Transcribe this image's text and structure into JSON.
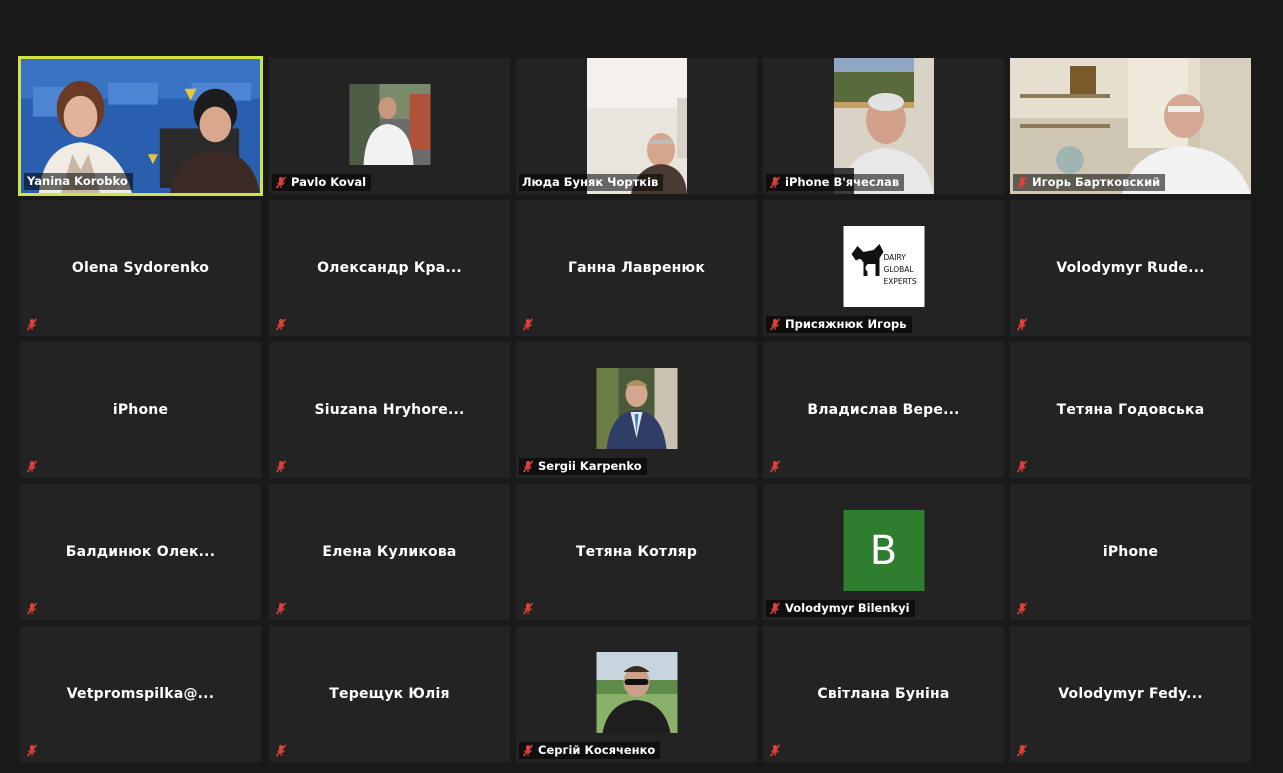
{
  "participants": [
    {
      "name": "Yanina Korobko",
      "type": "video-full",
      "active": true,
      "muted": false
    },
    {
      "name": "Pavlo Koval",
      "type": "video-small",
      "muted": true
    },
    {
      "name": "Люда Буняк Чортків",
      "type": "video-tall",
      "muted": false
    },
    {
      "name": "iPhone В'ячеслав",
      "type": "video-tall",
      "muted": true
    },
    {
      "name": "Игорь Бартковский",
      "type": "video-full",
      "muted": true
    },
    {
      "name": "Olena Sydorenko",
      "type": "name",
      "muted": true
    },
    {
      "name": "Олександр  Кра...",
      "type": "name",
      "muted": true
    },
    {
      "name": "Ганна Лавренюк",
      "type": "name",
      "muted": true
    },
    {
      "name": "Присяжнюк Игорь",
      "type": "logo",
      "logo_text": [
        "DAIRY",
        "GLOBAL",
        "EXPERTS"
      ],
      "muted": true
    },
    {
      "name": "Volodymyr  Rude...",
      "type": "name",
      "muted": true
    },
    {
      "name": "iPhone",
      "type": "name",
      "muted": true
    },
    {
      "name": "Siuzana  Hryhore...",
      "type": "name",
      "muted": true
    },
    {
      "name": "Sergii Karpenko",
      "type": "photo",
      "muted": true
    },
    {
      "name": "Владислав  Вере...",
      "type": "name",
      "muted": true
    },
    {
      "name": "Тетяна Годовська",
      "type": "name",
      "muted": true
    },
    {
      "name": "Балдинюк  Олек...",
      "type": "name",
      "muted": true
    },
    {
      "name": "Елена Куликова",
      "type": "name",
      "muted": true
    },
    {
      "name": "Тетяна Котляр",
      "type": "name",
      "muted": true
    },
    {
      "name": "Volodymyr Bilenkyi",
      "type": "avatar",
      "initial": "B",
      "muted": true
    },
    {
      "name": "iPhone",
      "type": "name",
      "muted": true
    },
    {
      "name": "Vetpromspilka@...",
      "type": "name",
      "muted": true
    },
    {
      "name": "Терещук Юлія",
      "type": "name",
      "muted": true
    },
    {
      "name": "Сергій Косяченко",
      "type": "photo2",
      "muted": true
    },
    {
      "name": "Світлана Буніна",
      "type": "name",
      "muted": true
    },
    {
      "name": "Volodymyr  Fedy...",
      "type": "name",
      "muted": true
    }
  ],
  "colors": {
    "active_border": "#cde34a",
    "muted_icon": "#e0403a",
    "avatar_bg": "#2f7d2e"
  }
}
